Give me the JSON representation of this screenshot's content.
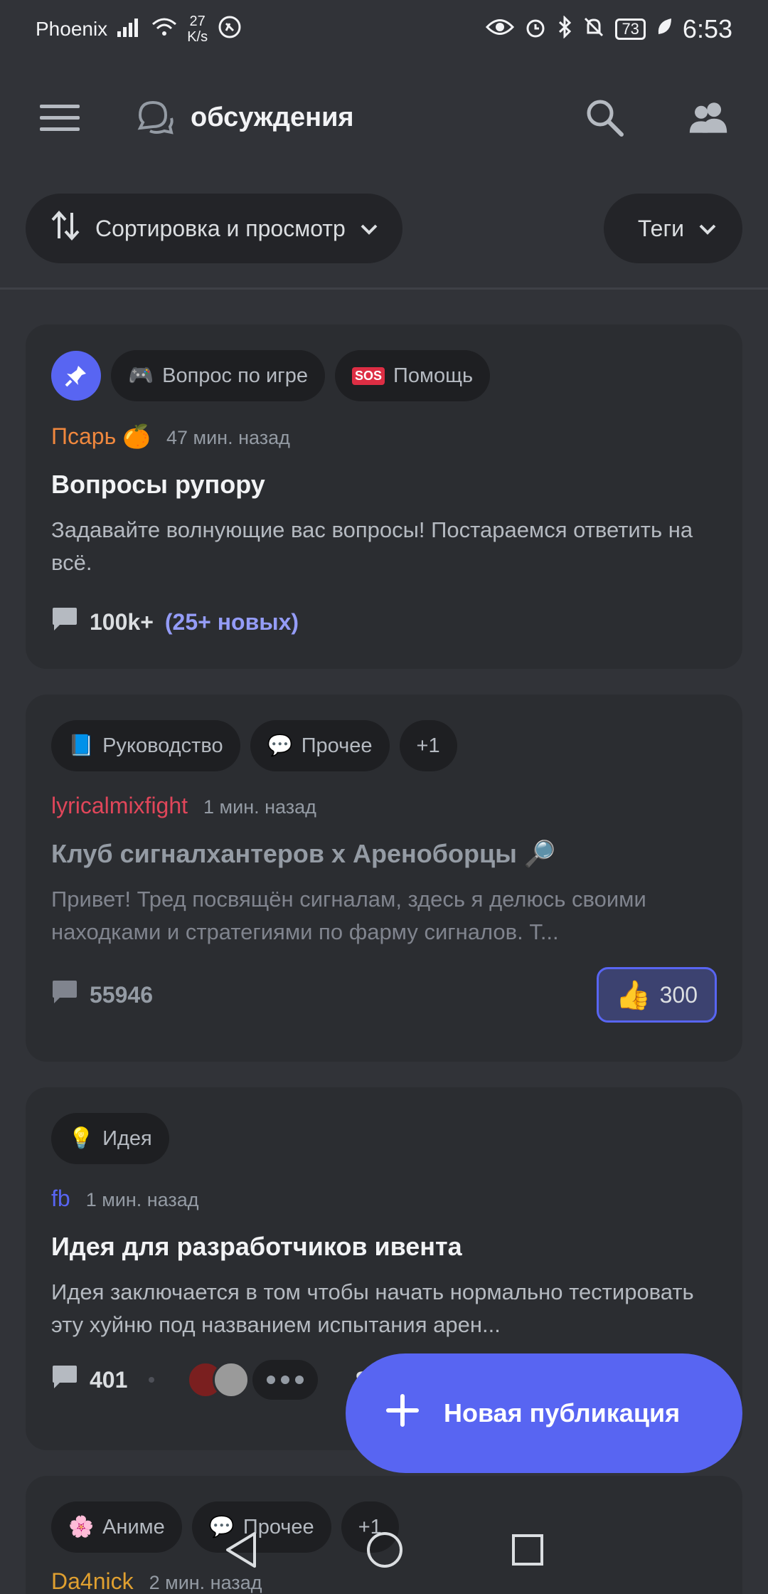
{
  "status_bar": {
    "carrier": "Phoenix",
    "speed_value": "27",
    "speed_unit": "K/s",
    "battery": "73",
    "time": "6:53"
  },
  "app_bar": {
    "title": "обсуждения",
    "icons": [
      "menu-icon",
      "threads-icon",
      "search-icon",
      "members-icon"
    ]
  },
  "filters": {
    "sort_label": "Сортировка и просмотр",
    "tags_label": "Теги"
  },
  "posts": [
    {
      "pinned": true,
      "tags": [
        {
          "emoji": "🎮",
          "label": "Вопрос по игре"
        },
        {
          "emoji": "🆘",
          "label": "Помощь"
        }
      ],
      "author": "Псарь 🍊",
      "author_color": "#f0883e",
      "time": "47 мин. назад",
      "title": "Вопросы рупору",
      "excerpt": "Задавайте волнующие вас вопросы! Постараемся ответить на всё.",
      "comments": "100k+",
      "new_comments": "(25+ новых)"
    },
    {
      "tags": [
        {
          "emoji": "📘",
          "label": "Руководство"
        },
        {
          "emoji": "💬",
          "label": "Прочее"
        },
        {
          "emoji": "",
          "label": "+1"
        }
      ],
      "author": "lyricalmixfight",
      "author_color": "#e0465a",
      "time": "1 мин. назад",
      "title": "Клуб сигналхантеров х Ареноборцы 🔎",
      "excerpt": "Привет! Тред посвящён сигналам, здесь я делюсь своими находками и стратегиями по фарму сигналов. Т...",
      "comments": "55946",
      "reaction_emoji": "👍",
      "reaction_count": "300"
    },
    {
      "tags": [
        {
          "emoji": "💡",
          "label": "Идея"
        }
      ],
      "author": "fb",
      "author_color": "#5865f2",
      "time": "1 мин. назад",
      "title": "Идея для разработчиков ивента",
      "excerpt": "Идея заключается в том чтобы начать нормально тестировать эту хуйню под названием испытания арен...",
      "comments": "401",
      "trailing_text": "Se"
    },
    {
      "tags": [
        {
          "emoji": "🌸",
          "label": "Аниме"
        },
        {
          "emoji": "💬",
          "label": "Прочее"
        },
        {
          "emoji": "",
          "label": "+1"
        }
      ],
      "author": "Da4nick",
      "author_color": "#e0a030",
      "time": "2 мин. назад"
    }
  ],
  "fab": {
    "label": "Новая публикация"
  },
  "nav": [
    "back-icon",
    "home-icon",
    "recents-icon"
  ]
}
